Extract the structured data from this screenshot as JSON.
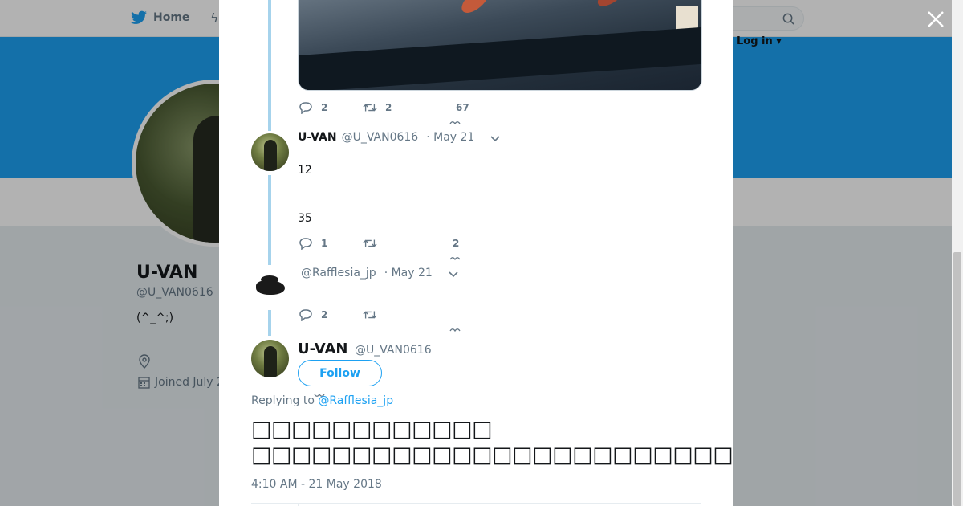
{
  "nav": {
    "home_label": "Home",
    "login_label": "Log in ▾"
  },
  "profile": {
    "name": "U-VAN",
    "handle": "@U_VAN0616",
    "bio": "(^_^;)",
    "joined": "Joined July 2"
  },
  "thread": [
    {
      "replies": "2",
      "retweets": "2",
      "likes": "67"
    },
    {
      "name": "U-VAN",
      "handle": "@U_VAN0616",
      "date": "· May 21",
      "text_lines": [
        "12",
        "35"
      ],
      "replies": "1",
      "retweets": "",
      "likes": "2"
    },
    {
      "name": "",
      "handle": "@Rafflesia_jp",
      "date": "· May 21",
      "replies": "2",
      "retweets": ""
    }
  ],
  "main_tweet": {
    "name": "U-VAN",
    "handle": "@U_VAN0616",
    "follow_label": "Follow",
    "replying_prefix": "Replying to",
    "replying_to": "@Rafflesia_jp",
    "text_line1": "□□□□□□□□□□□□",
    "text_line2": "□□□□□□□□□□□□□□□□□□□□□□□□□□□□□□□□□□□□□□□",
    "timestamp": "4:10 AM - 21 May 2018"
  },
  "colors": {
    "brand_blue": "#1da1f2",
    "thread_line": "#a6d3ec",
    "muted": "#657786"
  }
}
